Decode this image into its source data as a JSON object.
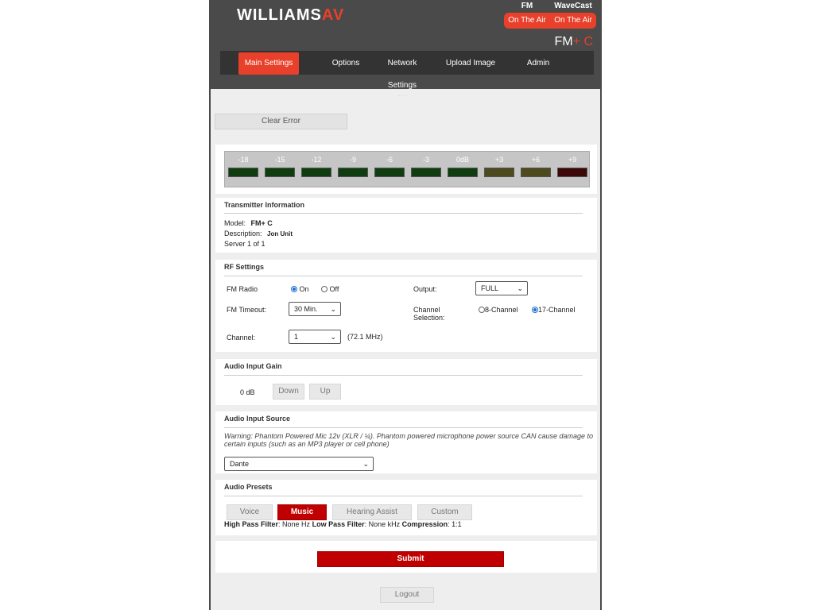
{
  "header": {
    "logo_williams": "WILLIAMS",
    "logo_av": "AV",
    "fm_title": "FM",
    "wavecast_title": "WaveCast",
    "fm_status": "On The Air",
    "wavecast_status": "On The Air",
    "model_prefix": "FM",
    "model_suffix": "+ C",
    "accent_color": "#e8402a"
  },
  "nav": {
    "items": [
      {
        "label": "Main Settings",
        "active": true
      },
      {
        "label": "Options",
        "active": false
      },
      {
        "label": "Network Settings",
        "active": false
      },
      {
        "label": "Upload Image",
        "active": false
      },
      {
        "label": "Admin",
        "active": false
      }
    ]
  },
  "clear_error_label": "Clear Error",
  "meter": {
    "labels": [
      "-18",
      "-15",
      "-12",
      "-9",
      "-6",
      "-3",
      "0dB",
      "+3",
      "+6",
      "+9"
    ],
    "colors": [
      "#0f3d10",
      "#0f3d10",
      "#0f3d10",
      "#0f3d10",
      "#0f3d10",
      "#0f3d10",
      "#0f3d10",
      "#4d4a1e",
      "#4d4a1e",
      "#3d0808"
    ]
  },
  "transmitter": {
    "title": "Transmitter Information",
    "model_label": "Model:",
    "model_value": "FM+ C",
    "description_label": "Description:",
    "description_value": "Jon Unit",
    "server_text": "Server 1 of 1"
  },
  "rf": {
    "title": "RF Settings",
    "fm_radio_label": "FM Radio",
    "on_label": "On",
    "off_label": "Off",
    "fm_radio_selected": "On",
    "output_label": "Output:",
    "output_value": "FULL",
    "fm_timeout_label": "FM Timeout:",
    "fm_timeout_value": "30 Min.",
    "channel_selection_label_1": "Channel",
    "channel_selection_label_2": "Selection:",
    "ch8_label": "8-Channel",
    "ch17_label": "17-Channel",
    "channel_selection_selected": "17-Channel",
    "channel_label": "Channel:",
    "channel_value": "1",
    "channel_freq": "(72.1 MHz)"
  },
  "gain": {
    "title": "Audio Input Gain",
    "value": "0 dB",
    "down_label": "Down",
    "up_label": "Up"
  },
  "source": {
    "title": "Audio Input Source",
    "warning": "Warning: Phantom Powered Mic 12v (XLR / ¼). Phantom powered microphone power source CAN cause damage to certain inputs (such as an MP3 player or cell phone)",
    "selected": "Dante"
  },
  "presets": {
    "title": "Audio Presets",
    "buttons": [
      {
        "label": "Voice",
        "active": false
      },
      {
        "label": "Music",
        "active": true
      },
      {
        "label": "Hearing Assist",
        "active": false
      },
      {
        "label": "Custom",
        "active": false
      }
    ],
    "hpf_label": "High Pass Filter",
    "hpf_value": ": None Hz",
    "lpf_label": "Low Pass Filter",
    "lpf_value": ": None kHz",
    "comp_label": "Compression",
    "comp_value": ": 1:1"
  },
  "submit_label": "Submit",
  "logout_label": "Logout"
}
